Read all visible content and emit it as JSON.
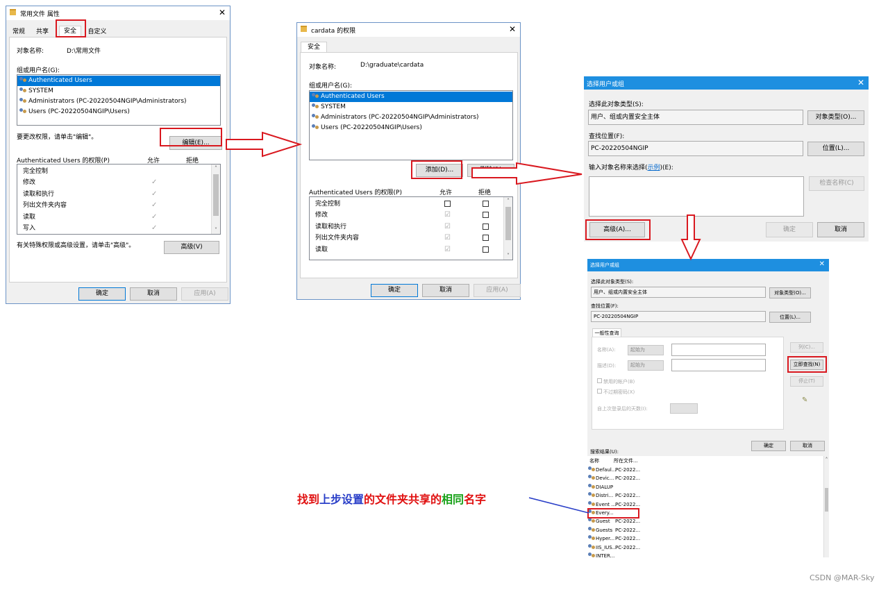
{
  "win1": {
    "title": "常用文件 属性",
    "tabs": [
      "常规",
      "共享",
      "安全",
      "自定义"
    ],
    "object_label": "对象名称:",
    "object_value": "D:\\常用文件",
    "group_label": "组或用户名(G):",
    "users": [
      "Authenticated Users",
      "SYSTEM",
      "Administrators (PC-20220504NGIP\\Administrators)",
      "Users (PC-20220504NGIP\\Users)"
    ],
    "edit_hint": "要更改权限，请单击\"编辑\"。",
    "edit_button": "编辑(E)...",
    "perm_label": "Authenticated Users 的权限(P)",
    "allow": "允许",
    "deny": "拒绝",
    "perms": [
      "完全控制",
      "修改",
      "读取和执行",
      "列出文件夹内容",
      "读取",
      "写入"
    ],
    "adv_hint": "有关特殊权限或高级设置，请单击\"高级\"。",
    "adv_button": "高级(V)",
    "ok": "确定",
    "cancel": "取消",
    "apply": "应用(A)"
  },
  "win2": {
    "title": "cardata 的权限",
    "tab": "安全",
    "object_label": "对象名称:",
    "object_value": "D:\\graduate\\cardata",
    "group_label": "组或用户名(G):",
    "users": [
      "Authenticated Users",
      "SYSTEM",
      "Administrators (PC-20220504NGIP\\Administrators)",
      "Users (PC-20220504NGIP\\Users)"
    ],
    "add_button": "添加(D)...",
    "remove_button": "删除(R)",
    "perm_label": "Authenticated Users 的权限(P)",
    "allow": "允许",
    "deny": "拒绝",
    "perms": [
      "完全控制",
      "修改",
      "读取和执行",
      "列出文件夹内容",
      "读取",
      "写入"
    ],
    "ok": "确定",
    "cancel": "取消",
    "apply": "应用(A)"
  },
  "win3": {
    "title": "选择用户或组",
    "type_label": "选择此对象类型(S):",
    "type_value": "用户、组或内置安全主体",
    "type_button": "对象类型(O)...",
    "loc_label": "查找位置(F):",
    "loc_value": "PC-20220504NGIP",
    "loc_button": "位置(L)...",
    "name_label": "输入对象名称来选择(",
    "name_link": "示例",
    "name_label_end": ")(E):",
    "check_button": "检查名称(C)",
    "adv_button": "高级(A)...",
    "ok": "确定",
    "cancel": "取消"
  },
  "win4": {
    "title": "选择用户或组",
    "type_label": "选择此对象类型(S):",
    "type_value": "用户、组或内置安全主体",
    "type_button": "对象类型(O)...",
    "loc_label": "查找位置(F):",
    "loc_value": "PC-20220504NGIP",
    "loc_button": "位置(L)...",
    "tab": "一般性查询",
    "name_label": "名称(A):",
    "name_mode": "起始为",
    "desc_label": "描述(D):",
    "desc_mode": "起始为",
    "disabled_acct": "禁用的帐户(B)",
    "no_expire": "不过期密码(X)",
    "days_label": "自上次登录后的天数(I):",
    "col_button": "列(C)...",
    "find_button": "立即查找(N)",
    "stop_button": "停止(T)",
    "ok": "确定",
    "cancel": "取消",
    "results_label": "搜索结果(U):",
    "col_name": "名称",
    "col_folder": "所在文件...",
    "results": [
      {
        "name": "Defaul...",
        "folder": "PC-2022..."
      },
      {
        "name": "Devic...",
        "folder": "PC-2022..."
      },
      {
        "name": "DIALUP",
        "folder": ""
      },
      {
        "name": "Distri...",
        "folder": "PC-2022..."
      },
      {
        "name": "Event ...",
        "folder": "PC-2022..."
      },
      {
        "name": "Every...",
        "folder": ""
      },
      {
        "name": "Guest",
        "folder": "PC-2022..."
      },
      {
        "name": "Guests",
        "folder": "PC-2022..."
      },
      {
        "name": "Hyper...",
        "folder": "PC-2022..."
      },
      {
        "name": "IIS_IUS...",
        "folder": "PC-2022..."
      },
      {
        "name": "INTER...",
        "folder": ""
      }
    ]
  },
  "annotation": {
    "parts": [
      "找到",
      "上步设置",
      "的文件夹共享的",
      "相同",
      "名字"
    ],
    "colors": [
      "#e01010",
      "#2a3fc8",
      "#e01010",
      "#17a117",
      "#e01010"
    ]
  },
  "watermark": "CSDN @MAR-Sky"
}
